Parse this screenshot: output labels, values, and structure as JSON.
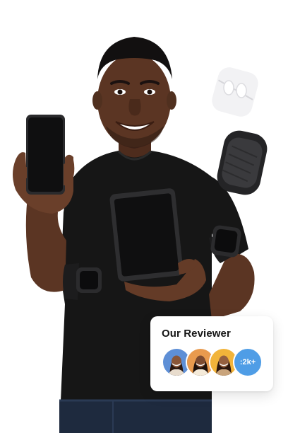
{
  "reviewer_card": {
    "title": "Our Reviewer",
    "avatars": [
      {
        "icon": "reviewer-avatar-1",
        "bg": "#5e8fd6"
      },
      {
        "icon": "reviewer-avatar-2",
        "bg": "#e89a4e"
      },
      {
        "icon": "reviewer-avatar-3",
        "bg": "#f2b43a"
      }
    ],
    "count_label": ":2k+",
    "count_color": "#4f9de6"
  },
  "colors": {
    "shirt": "#161616",
    "skin": "#5b3523",
    "device_screen": "#0f0f10"
  }
}
